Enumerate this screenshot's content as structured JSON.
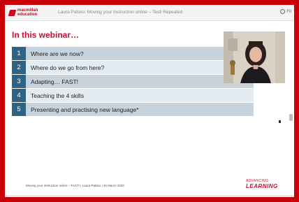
{
  "topbar": {
    "logo_line1": "macmillan",
    "logo_line2": "education",
    "meeting_title": "Laura Patsko: Moving your instruction online – Tesfi Repeated",
    "top_right": "Fit"
  },
  "slide": {
    "title": "In this webinar…",
    "agenda": [
      {
        "num": "1",
        "text": "Where are we now?"
      },
      {
        "num": "2",
        "text": "Where do we go from here?"
      },
      {
        "num": "3",
        "text": "Adapting… FAST!"
      },
      {
        "num": "4",
        "text": "Teaching the 4 skills"
      },
      {
        "num": "5",
        "text": "Presenting and practising new language*"
      }
    ],
    "footer": "Moving your instruction online – FAST! | Laura Patsko | 26 March 2020",
    "brand_small": "ADVANCING",
    "brand_big": "LEARNING"
  },
  "colors": {
    "frame": "#c8000a",
    "accent": "#c8102e",
    "number_box": "#2f6384",
    "row_dark": "#c7d4de",
    "row_light": "#e4ebf0"
  },
  "icons": {
    "top_right": "circle-icon",
    "logo": "macmillan-logo-icon"
  }
}
